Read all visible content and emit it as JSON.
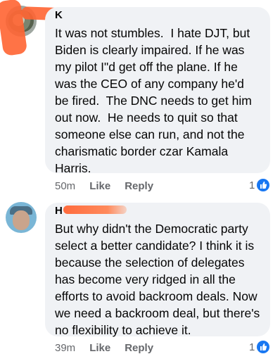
{
  "comments": [
    {
      "author": "K",
      "text": "It was not stumbles.  I hate DJT, but Biden is clearly impaired. If he was my pilot I\"d get off the plane. If he was the CEO of any company he'd be fired.  The DNC needs to get him out now.  He needs to quit so that someone else can run, and not the charismatic border czar Kamala Harris.",
      "time": "50m",
      "like_label": "Like",
      "reply_label": "Reply",
      "reaction_count": "1"
    },
    {
      "author": "H",
      "text": "But why didn't the Democratic party select a better candidate? I think it is because the selection of delegates has become very ridged in all the efforts to avoid backroom deals. Now we need a backroom deal, but there's no flexibility to achieve it.",
      "time": "39m",
      "like_label": "Like",
      "reply_label": "Reply",
      "reaction_count": "1"
    }
  ],
  "colors": {
    "bubble": "#f0f2f5",
    "accent": "#1877f2",
    "redaction": "#ff6b3d"
  }
}
